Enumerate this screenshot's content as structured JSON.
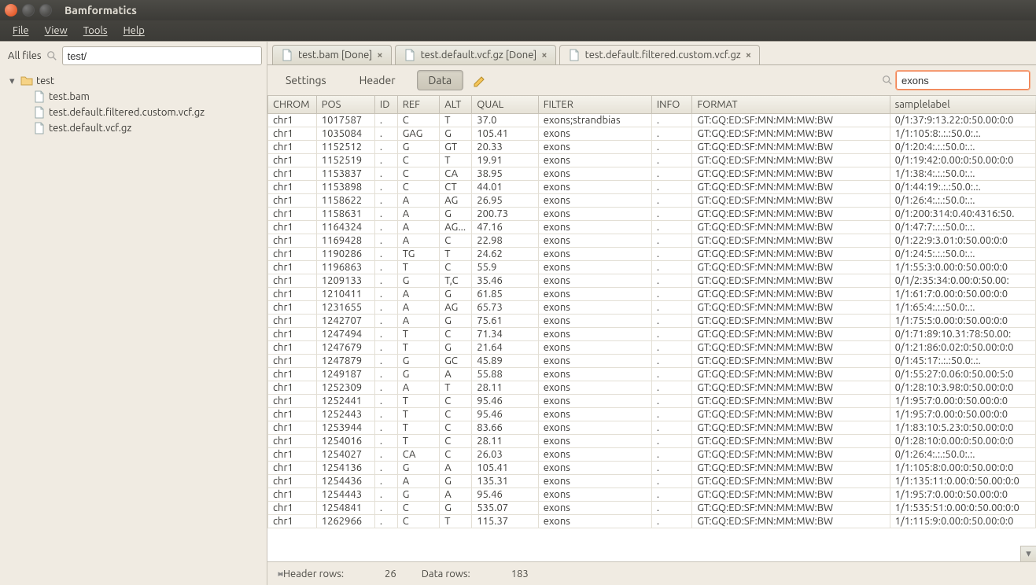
{
  "window": {
    "title": "Bamformatics"
  },
  "menubar": {
    "file": "File",
    "view": "View",
    "tools": "Tools",
    "help": "Help"
  },
  "sidebar": {
    "label": "All files",
    "search_value": "test/",
    "root": "test",
    "files": [
      "test.bam",
      "test.default.filtered.custom.vcf.gz",
      "test.default.vcf.gz"
    ]
  },
  "tabs": [
    {
      "icon": "file",
      "label": "test.bam [Done]",
      "closable": true,
      "active": false
    },
    {
      "icon": "file",
      "label": "test.default.vcf.gz [Done]",
      "closable": true,
      "active": false
    },
    {
      "icon": "file",
      "label": "test.default.filtered.custom.vcf.gz",
      "closable": true,
      "active": true
    }
  ],
  "toolbar": {
    "settings": "Settings",
    "header": "Header",
    "data": "Data",
    "filter_value": "exons"
  },
  "table": {
    "columns": [
      "CHROM",
      "POS",
      "ID",
      "REF",
      "ALT",
      "QUAL",
      "FILTER",
      "INFO",
      "FORMAT",
      "samplelabel"
    ],
    "format_value": "GT:GQ:ED:SF:MN:MM:MW:BW",
    "rows": [
      {
        "chrom": "chr1",
        "pos": "1017587",
        "id": ".",
        "ref": "C",
        "alt": "T",
        "qual": "37.0",
        "filter": "exons;strandbias",
        "info": ".",
        "sample": "0/1:37:9:13.22:0:50.00:0:0"
      },
      {
        "chrom": "chr1",
        "pos": "1035084",
        "id": ".",
        "ref": "GAG",
        "alt": "G",
        "qual": "105.41",
        "filter": "exons",
        "info": ".",
        "sample": "1/1:105:8:.:.:50.0:.:."
      },
      {
        "chrom": "chr1",
        "pos": "1152512",
        "id": ".",
        "ref": "G",
        "alt": "GT",
        "qual": "20.33",
        "filter": "exons",
        "info": ".",
        "sample": "0/1:20:4:.:.:50.0:.:."
      },
      {
        "chrom": "chr1",
        "pos": "1152519",
        "id": ".",
        "ref": "C",
        "alt": "T",
        "qual": "19.91",
        "filter": "exons",
        "info": ".",
        "sample": "0/1:19:42:0.00:0:50.00:0:0"
      },
      {
        "chrom": "chr1",
        "pos": "1153837",
        "id": ".",
        "ref": "C",
        "alt": "CA",
        "qual": "38.95",
        "filter": "exons",
        "info": ".",
        "sample": "1/1:38:4:.:.:50.0:.:."
      },
      {
        "chrom": "chr1",
        "pos": "1153898",
        "id": ".",
        "ref": "C",
        "alt": "CT",
        "qual": "44.01",
        "filter": "exons",
        "info": ".",
        "sample": "0/1:44:19:.:.:50.0:.:."
      },
      {
        "chrom": "chr1",
        "pos": "1158622",
        "id": ".",
        "ref": "A",
        "alt": "AG",
        "qual": "26.95",
        "filter": "exons",
        "info": ".",
        "sample": "0/1:26:4:.:.:50.0:.:."
      },
      {
        "chrom": "chr1",
        "pos": "1158631",
        "id": ".",
        "ref": "A",
        "alt": "G",
        "qual": "200.73",
        "filter": "exons",
        "info": ".",
        "sample": "0/1:200:314:0.40:4316:50."
      },
      {
        "chrom": "chr1",
        "pos": "1164324",
        "id": ".",
        "ref": "A",
        "alt": "AG...",
        "qual": "47.16",
        "filter": "exons",
        "info": ".",
        "sample": "0/1:47:7:.:.:50.0:.:."
      },
      {
        "chrom": "chr1",
        "pos": "1169428",
        "id": ".",
        "ref": "A",
        "alt": "C",
        "qual": "22.98",
        "filter": "exons",
        "info": ".",
        "sample": "0/1:22:9:3.01:0:50.00:0:0"
      },
      {
        "chrom": "chr1",
        "pos": "1190286",
        "id": ".",
        "ref": "TG",
        "alt": "T",
        "qual": "24.62",
        "filter": "exons",
        "info": ".",
        "sample": "0/1:24:5:.:.:50.0:.:."
      },
      {
        "chrom": "chr1",
        "pos": "1196863",
        "id": ".",
        "ref": "T",
        "alt": "C",
        "qual": "55.9",
        "filter": "exons",
        "info": ".",
        "sample": "1/1:55:3:0.00:0:50.00:0:0"
      },
      {
        "chrom": "chr1",
        "pos": "1209133",
        "id": ".",
        "ref": "G",
        "alt": "T,C",
        "qual": "35.46",
        "filter": "exons",
        "info": ".",
        "sample": "0/1/2:35:34:0.00:0:50.00:"
      },
      {
        "chrom": "chr1",
        "pos": "1210411",
        "id": ".",
        "ref": "A",
        "alt": "G",
        "qual": "61.85",
        "filter": "exons",
        "info": ".",
        "sample": "1/1:61:7:0.00:0:50.00:0:0"
      },
      {
        "chrom": "chr1",
        "pos": "1231655",
        "id": ".",
        "ref": "A",
        "alt": "AG",
        "qual": "65.73",
        "filter": "exons",
        "info": ".",
        "sample": "1/1:65:4:.:.:50.0:.:."
      },
      {
        "chrom": "chr1",
        "pos": "1242707",
        "id": ".",
        "ref": "A",
        "alt": "G",
        "qual": "75.61",
        "filter": "exons",
        "info": ".",
        "sample": "1/1:75:5:0.00:0:50.00:0:0"
      },
      {
        "chrom": "chr1",
        "pos": "1247494",
        "id": ".",
        "ref": "T",
        "alt": "C",
        "qual": "71.34",
        "filter": "exons",
        "info": ".",
        "sample": "0/1:71:89:10.31:78:50.00:"
      },
      {
        "chrom": "chr1",
        "pos": "1247679",
        "id": ".",
        "ref": "T",
        "alt": "G",
        "qual": "21.64",
        "filter": "exons",
        "info": ".",
        "sample": "0/1:21:86:0.02:0:50.00:0:0"
      },
      {
        "chrom": "chr1",
        "pos": "1247879",
        "id": ".",
        "ref": "G",
        "alt": "GC",
        "qual": "45.89",
        "filter": "exons",
        "info": ".",
        "sample": "0/1:45:17:.:.:50.0:.:."
      },
      {
        "chrom": "chr1",
        "pos": "1249187",
        "id": ".",
        "ref": "G",
        "alt": "A",
        "qual": "55.88",
        "filter": "exons",
        "info": ".",
        "sample": "0/1:55:27:0.06:0:50.00:5:0"
      },
      {
        "chrom": "chr1",
        "pos": "1252309",
        "id": ".",
        "ref": "A",
        "alt": "T",
        "qual": "28.11",
        "filter": "exons",
        "info": ".",
        "sample": "0/1:28:10:3.98:0:50.00:0:0"
      },
      {
        "chrom": "chr1",
        "pos": "1252441",
        "id": ".",
        "ref": "T",
        "alt": "C",
        "qual": "95.46",
        "filter": "exons",
        "info": ".",
        "sample": "1/1:95:7:0.00:0:50.00:0:0"
      },
      {
        "chrom": "chr1",
        "pos": "1252443",
        "id": ".",
        "ref": "T",
        "alt": "C",
        "qual": "95.46",
        "filter": "exons",
        "info": ".",
        "sample": "1/1:95:7:0.00:0:50.00:0:0"
      },
      {
        "chrom": "chr1",
        "pos": "1253944",
        "id": ".",
        "ref": "T",
        "alt": "C",
        "qual": "83.66",
        "filter": "exons",
        "info": ".",
        "sample": "1/1:83:10:5.23:0:50.00:0:0"
      },
      {
        "chrom": "chr1",
        "pos": "1254016",
        "id": ".",
        "ref": "T",
        "alt": "C",
        "qual": "28.11",
        "filter": "exons",
        "info": ".",
        "sample": "0/1:28:10:0.00:0:50.00:0:0"
      },
      {
        "chrom": "chr1",
        "pos": "1254027",
        "id": ".",
        "ref": "CA",
        "alt": "C",
        "qual": "26.03",
        "filter": "exons",
        "info": ".",
        "sample": "0/1:26:4:.:.:50.0:.:."
      },
      {
        "chrom": "chr1",
        "pos": "1254136",
        "id": ".",
        "ref": "G",
        "alt": "A",
        "qual": "105.41",
        "filter": "exons",
        "info": ".",
        "sample": "1/1:105:8:0.00:0:50.00:0:0"
      },
      {
        "chrom": "chr1",
        "pos": "1254436",
        "id": ".",
        "ref": "A",
        "alt": "G",
        "qual": "135.31",
        "filter": "exons",
        "info": ".",
        "sample": "1/1:135:11:0.00:0:50.00:0:0"
      },
      {
        "chrom": "chr1",
        "pos": "1254443",
        "id": ".",
        "ref": "G",
        "alt": "A",
        "qual": "95.46",
        "filter": "exons",
        "info": ".",
        "sample": "1/1:95:7:0.00:0:50.00:0:0"
      },
      {
        "chrom": "chr1",
        "pos": "1254841",
        "id": ".",
        "ref": "C",
        "alt": "G",
        "qual": "535.07",
        "filter": "exons",
        "info": ".",
        "sample": "1/1:535:51:0.00:0:50.00:0:0"
      },
      {
        "chrom": "chr1",
        "pos": "1262966",
        "id": ".",
        "ref": "C",
        "alt": "T",
        "qual": "115.37",
        "filter": "exons",
        "info": ".",
        "sample": "1/1:115:9:0.00:0:50.00:0:0"
      }
    ]
  },
  "status": {
    "header_rows_label": "Header rows:",
    "header_rows_value": "26",
    "data_rows_label": "Data rows:",
    "data_rows_value": "183"
  }
}
